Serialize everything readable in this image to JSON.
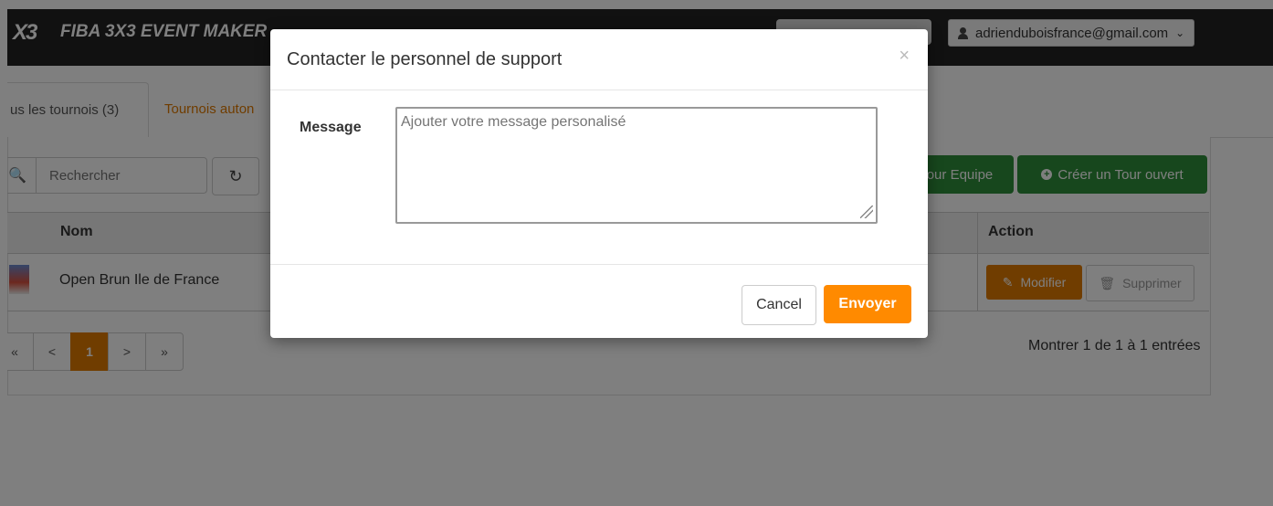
{
  "navbar": {
    "logo_text": "X3",
    "brand_name": "FIBA 3X3 EVENT MAKER",
    "user_email": "adrienduboisfrance@gmail.com",
    "user_icon": "user-icon",
    "dropdown_icon": "chevron-down-icon",
    "dropdown_glyph": "⌄"
  },
  "tabs": [
    {
      "label": "us les tournois (3)"
    },
    {
      "label": "Tournois auton"
    }
  ],
  "toolbar": {
    "search_placeholder": "Rechercher",
    "refresh_glyph": "↻",
    "search_glyph": "🔍",
    "btn_tour_equipe": "our Equipe",
    "btn_tour_ouvert": "Créer un Tour ouvert",
    "plus_glyph": "+"
  },
  "table": {
    "headers": {
      "nom": "Nom",
      "action": "Action"
    },
    "rows": [
      {
        "name": "Open Brun Ile de France",
        "modify": "Modifier",
        "delete": "Supprimer"
      }
    ],
    "modify_glyph": "✎",
    "delete_glyph": "🗑"
  },
  "pagination": {
    "first": "«",
    "prev": "<",
    "current": "1",
    "next": ">",
    "last": "»",
    "entries_text": "Montrer 1 de 1 à 1 entrées"
  },
  "modal": {
    "title": "Contacter le personnel de support",
    "close_glyph": "×",
    "message_label": "Message",
    "message_placeholder": "Ajouter votre message personalisé",
    "cancel_label": "Cancel",
    "send_label": "Envoyer"
  },
  "colors": {
    "navbar": "#222222",
    "accent_orange": "#ff8a00",
    "green": "#2f8f3a"
  }
}
